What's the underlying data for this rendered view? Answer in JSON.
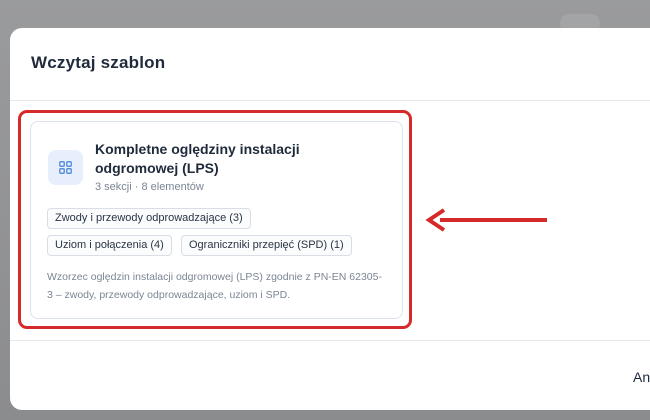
{
  "modal": {
    "title": "Wczytaj szablon",
    "footer_button_label": "Anuluj"
  },
  "template_card": {
    "icon": "grid-icon",
    "title": "Kompletne oględziny instalacji odgromowej (LPS)",
    "meta": "3 sekcji · 8 elementów",
    "tags": [
      "Zwody i przewody odprowadzające (3)",
      "Uziom i połączenia (4)",
      "Ograniczniki przepięć (SPD) (1)"
    ],
    "description": "Wzorzec oględzin instalacji odgromowej (LPS) zgodnie z PN-EN 62305-3 – zwody, przewody odprowadzające, uziom i SPD."
  },
  "colors": {
    "annotation_red": "#d62a2a",
    "icon_blue": "#5b8fd9",
    "icon_bg": "#e7effc",
    "title_text": "#1f2a3a"
  }
}
